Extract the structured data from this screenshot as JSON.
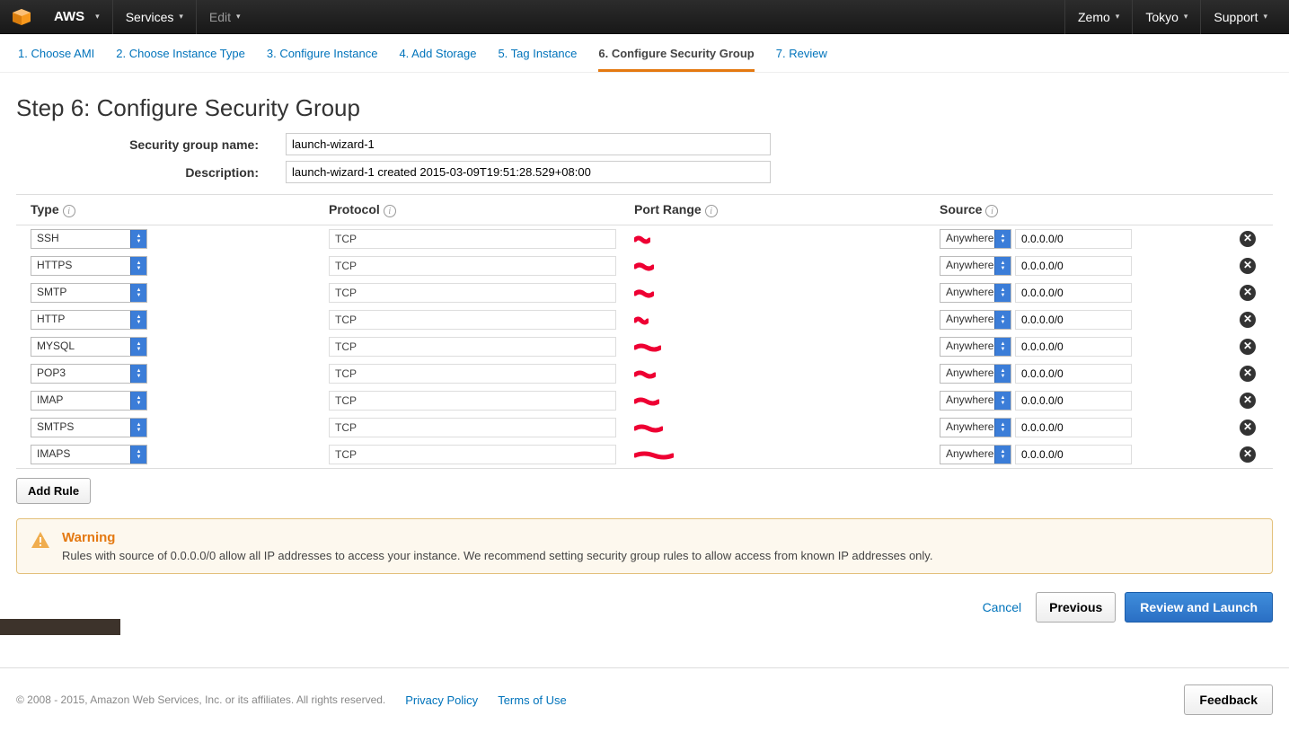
{
  "topbar": {
    "aws": "AWS",
    "services": "Services",
    "edit": "Edit",
    "user": "Zemo",
    "region": "Tokyo",
    "support": "Support"
  },
  "steps": [
    "1. Choose AMI",
    "2. Choose Instance Type",
    "3. Configure Instance",
    "4. Add Storage",
    "5. Tag Instance",
    "6. Configure Security Group",
    "7. Review"
  ],
  "active_step_index": 5,
  "page_title": "Step 6: Configure Security Group",
  "form": {
    "name_label": "Security group name:",
    "name_value": "launch-wizard-1",
    "desc_label": "Description:",
    "desc_value": "launch-wizard-1 created 2015-03-09T19:51:28.529+08:00"
  },
  "table": {
    "headers": {
      "type": "Type",
      "protocol": "Protocol",
      "port": "Port Range",
      "source": "Source"
    },
    "rows": [
      {
        "type": "SSH",
        "protocol": "TCP",
        "source_sel": "Anywhere",
        "source_ip": "0.0.0.0/0"
      },
      {
        "type": "HTTPS",
        "protocol": "TCP",
        "source_sel": "Anywhere",
        "source_ip": "0.0.0.0/0"
      },
      {
        "type": "SMTP",
        "protocol": "TCP",
        "source_sel": "Anywhere",
        "source_ip": "0.0.0.0/0"
      },
      {
        "type": "HTTP",
        "protocol": "TCP",
        "source_sel": "Anywhere",
        "source_ip": "0.0.0.0/0"
      },
      {
        "type": "MYSQL",
        "protocol": "TCP",
        "source_sel": "Anywhere",
        "source_ip": "0.0.0.0/0"
      },
      {
        "type": "POP3",
        "protocol": "TCP",
        "source_sel": "Anywhere",
        "source_ip": "0.0.0.0/0"
      },
      {
        "type": "IMAP",
        "protocol": "TCP",
        "source_sel": "Anywhere",
        "source_ip": "0.0.0.0/0"
      },
      {
        "type": "SMTPS",
        "protocol": "TCP",
        "source_sel": "Anywhere",
        "source_ip": "0.0.0.0/0"
      },
      {
        "type": "IMAPS",
        "protocol": "TCP",
        "source_sel": "Anywhere",
        "source_ip": "0.0.0.0/0"
      }
    ],
    "add_rule": "Add Rule"
  },
  "warning": {
    "title": "Warning",
    "text": "Rules with source of 0.0.0.0/0 allow all IP addresses to access your instance. We recommend setting security group rules to allow access from known IP addresses only."
  },
  "actions": {
    "cancel": "Cancel",
    "previous": "Previous",
    "launch": "Review and Launch"
  },
  "footer": {
    "copyright": "© 2008 - 2015, Amazon Web Services, Inc. or its affiliates. All rights reserved.",
    "privacy": "Privacy Policy",
    "terms": "Terms of Use",
    "feedback": "Feedback"
  }
}
